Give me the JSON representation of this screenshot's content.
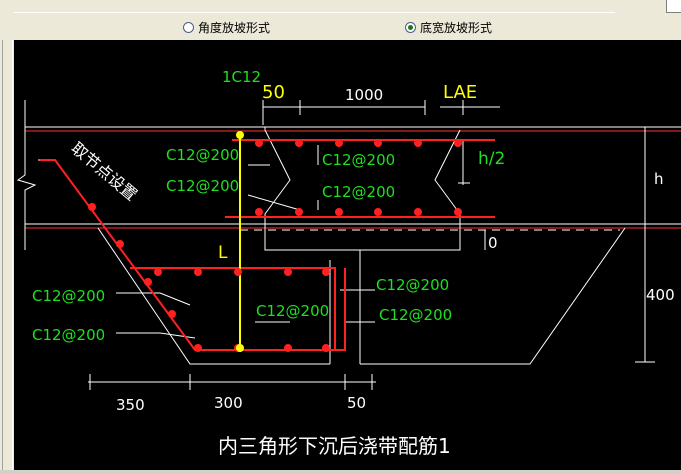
{
  "options": {
    "angle_label": "角度放坡形式",
    "width_label": "底宽放坡形式",
    "selected": "width"
  },
  "drawing": {
    "title": "内三角形下沉后浇带配筋1",
    "rebar_tag": "1C12",
    "dim_top_50": "50",
    "dim_top_1000": "1000",
    "dim_top_lae": "LAE",
    "dim_half_h": "h/2",
    "dim_h": "h",
    "dim_0": "0",
    "dim_400": "400",
    "dim_L": "L",
    "dim_bottom_350": "350",
    "dim_bottom_300": "300",
    "dim_bottom_50": "50",
    "callout_text": "取节点设置",
    "rebar_label": "C12@200"
  },
  "colors": {
    "background": "#000000",
    "line": "#ffffff",
    "rebar": "#ff2020",
    "text": "#1fe01f",
    "accent": "#ffff00"
  }
}
